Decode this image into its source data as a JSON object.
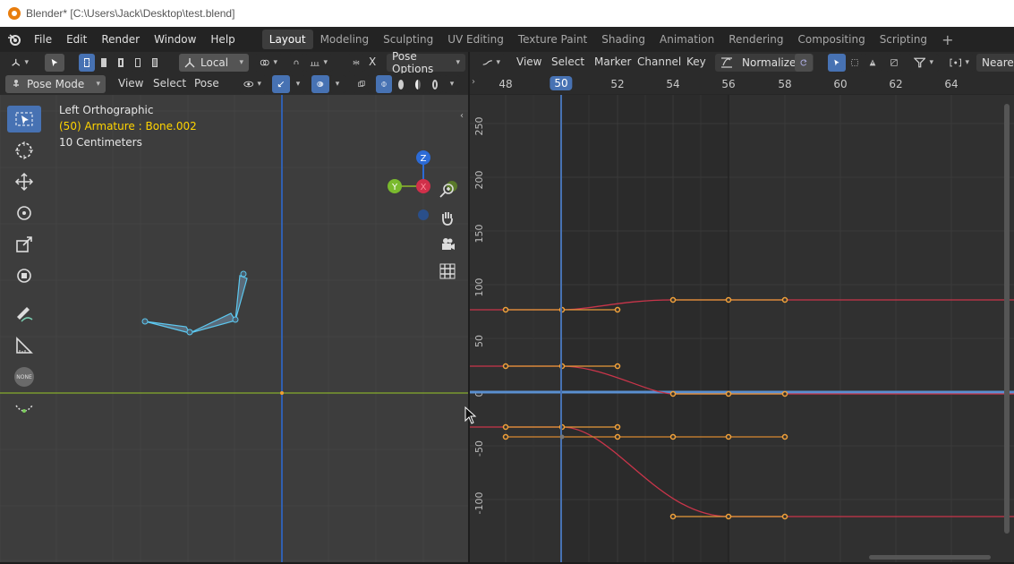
{
  "titlebar": {
    "title": "Blender* [C:\\Users\\Jack\\Desktop\\test.blend]"
  },
  "menus": [
    "File",
    "Edit",
    "Render",
    "Window",
    "Help"
  ],
  "workspaces": [
    {
      "label": "Layout",
      "active": true
    },
    {
      "label": "Modeling"
    },
    {
      "label": "Sculpting"
    },
    {
      "label": "UV Editing"
    },
    {
      "label": "Texture Paint"
    },
    {
      "label": "Shading"
    },
    {
      "label": "Animation"
    },
    {
      "label": "Rendering"
    },
    {
      "label": "Compositing"
    },
    {
      "label": "Scripting"
    }
  ],
  "add_workspace": "+",
  "viewport": {
    "orientation": "Local",
    "pose_options": "Pose Options",
    "x_label": "X",
    "mode": "Pose Mode",
    "menus": [
      "View",
      "Select",
      "Pose"
    ],
    "view_name": "Left Orthographic",
    "active_object": "(50) Armature : Bone.002",
    "grid_scale": "10 Centimeters",
    "gizmo_axes": {
      "z": "Z",
      "y": "Y",
      "x": "X"
    },
    "none_label": "NONE"
  },
  "graph_editor": {
    "menus": [
      "View",
      "Select",
      "Marker",
      "Channel",
      "Key"
    ],
    "normalize_label": "Normalize",
    "interpolation": "Neares",
    "frames": [
      "48",
      "50",
      "52",
      "54",
      "56",
      "58",
      "60",
      "62",
      "64"
    ],
    "current_frame": "50",
    "y_labels": [
      "250",
      "200",
      "150",
      "100",
      "50",
      "0",
      "-50",
      "-100"
    ]
  },
  "colors": {
    "accent": "#4772b3",
    "curve": "#c9354a",
    "handle": "#e69a3a",
    "keyframe": "#f3a23a",
    "x_axis": "#7a9a2e",
    "z_axis": "#2c6bd6"
  }
}
